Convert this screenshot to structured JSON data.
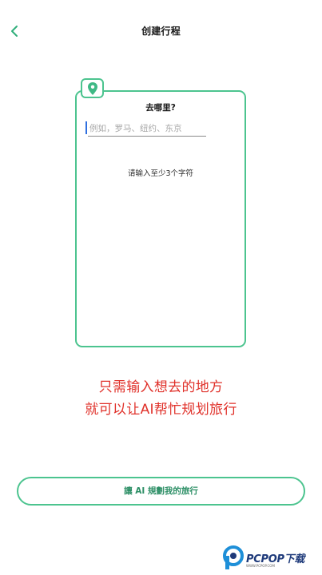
{
  "header": {
    "title": "创建行程",
    "back_icon": "chevron-left-icon"
  },
  "card": {
    "badge_icon": "map-pin-icon",
    "question": "去哪里?",
    "input_value": "",
    "input_placeholder": "例如，罗马、纽约、东京",
    "hint": "请输入至少3个字符"
  },
  "promo": {
    "line1": "只需输入想去的地方",
    "line2": "就可以让AI帮忙规划旅行"
  },
  "action": {
    "plan_label": "讓 AI 規劃我的旅行"
  },
  "watermark": {
    "text": "PCPOP下载",
    "sub": "WWW.PCPOP.COM"
  },
  "colors": {
    "accent_green": "#4cc48f",
    "button_text_green": "#2d8f66",
    "promo_red": "#e0312a",
    "caret_blue": "#2f6fe0"
  }
}
